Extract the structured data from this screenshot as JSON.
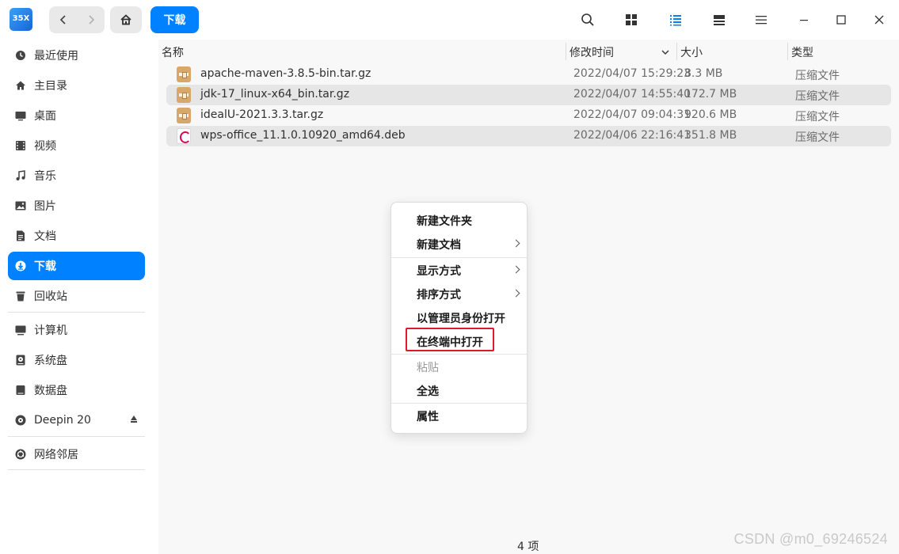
{
  "toolbar": {
    "back_icon": "back-arrow-icon",
    "forward_icon": "forward-arrow-icon",
    "home_icon": "home-icon",
    "breadcrumb": "下载"
  },
  "sidebar": {
    "items": [
      {
        "label": "最近使用",
        "icon": "clock-icon"
      },
      {
        "label": "主目录",
        "icon": "home-icon"
      },
      {
        "label": "桌面",
        "icon": "desktop-icon"
      },
      {
        "label": "视频",
        "icon": "video-icon"
      },
      {
        "label": "音乐",
        "icon": "music-icon"
      },
      {
        "label": "图片",
        "icon": "picture-icon"
      },
      {
        "label": "文档",
        "icon": "document-icon"
      },
      {
        "label": "下载",
        "icon": "download-icon",
        "active": true
      },
      {
        "label": "回收站",
        "icon": "trash-icon"
      },
      {
        "label": "计算机",
        "icon": "computer-icon"
      },
      {
        "label": "系统盘",
        "icon": "disk-icon"
      },
      {
        "label": "数据盘",
        "icon": "disk-icon"
      },
      {
        "label": "Deepin 20",
        "icon": "optical-disc-icon"
      },
      {
        "label": "网络邻居",
        "icon": "network-icon"
      }
    ]
  },
  "columns": {
    "name": "名称",
    "modified": "修改时间",
    "size": "大小",
    "type": "类型"
  },
  "files": [
    {
      "name": "apache-maven-3.8.5-bin.tar.gz",
      "modified": "2022/04/07 15:29:23",
      "size": "8.3 MB",
      "type": "压缩文件",
      "icon": "archive-icon"
    },
    {
      "name": "jdk-17_linux-x64_bin.tar.gz",
      "modified": "2022/04/07 14:55:40",
      "size": "172.7 MB",
      "type": "压缩文件",
      "icon": "archive-icon"
    },
    {
      "name": "idealU-2021.3.3.tar.gz",
      "modified": "2022/04/07 09:04:31",
      "size": "920.6 MB",
      "type": "压缩文件",
      "icon": "archive-icon"
    },
    {
      "name": "wps-office_11.1.0.10920_amd64.deb",
      "modified": "2022/04/06 22:16:41",
      "size": "351.8 MB",
      "type": "压缩文件",
      "icon": "debian-package-icon"
    }
  ],
  "status_bar": "4 项",
  "context_menu": {
    "new_folder": "新建文件夹",
    "new_document": "新建文档",
    "display_mode": "显示方式",
    "sort_by": "排序方式",
    "open_as_admin": "以管理员身份打开",
    "open_in_terminal": "在终端中打开",
    "paste": "粘贴",
    "select_all": "全选",
    "properties": "属性"
  },
  "watermark": "CSDN @m0_69246524",
  "colors": {
    "accent": "#0081ff",
    "highlight_box": "#e0182d"
  }
}
